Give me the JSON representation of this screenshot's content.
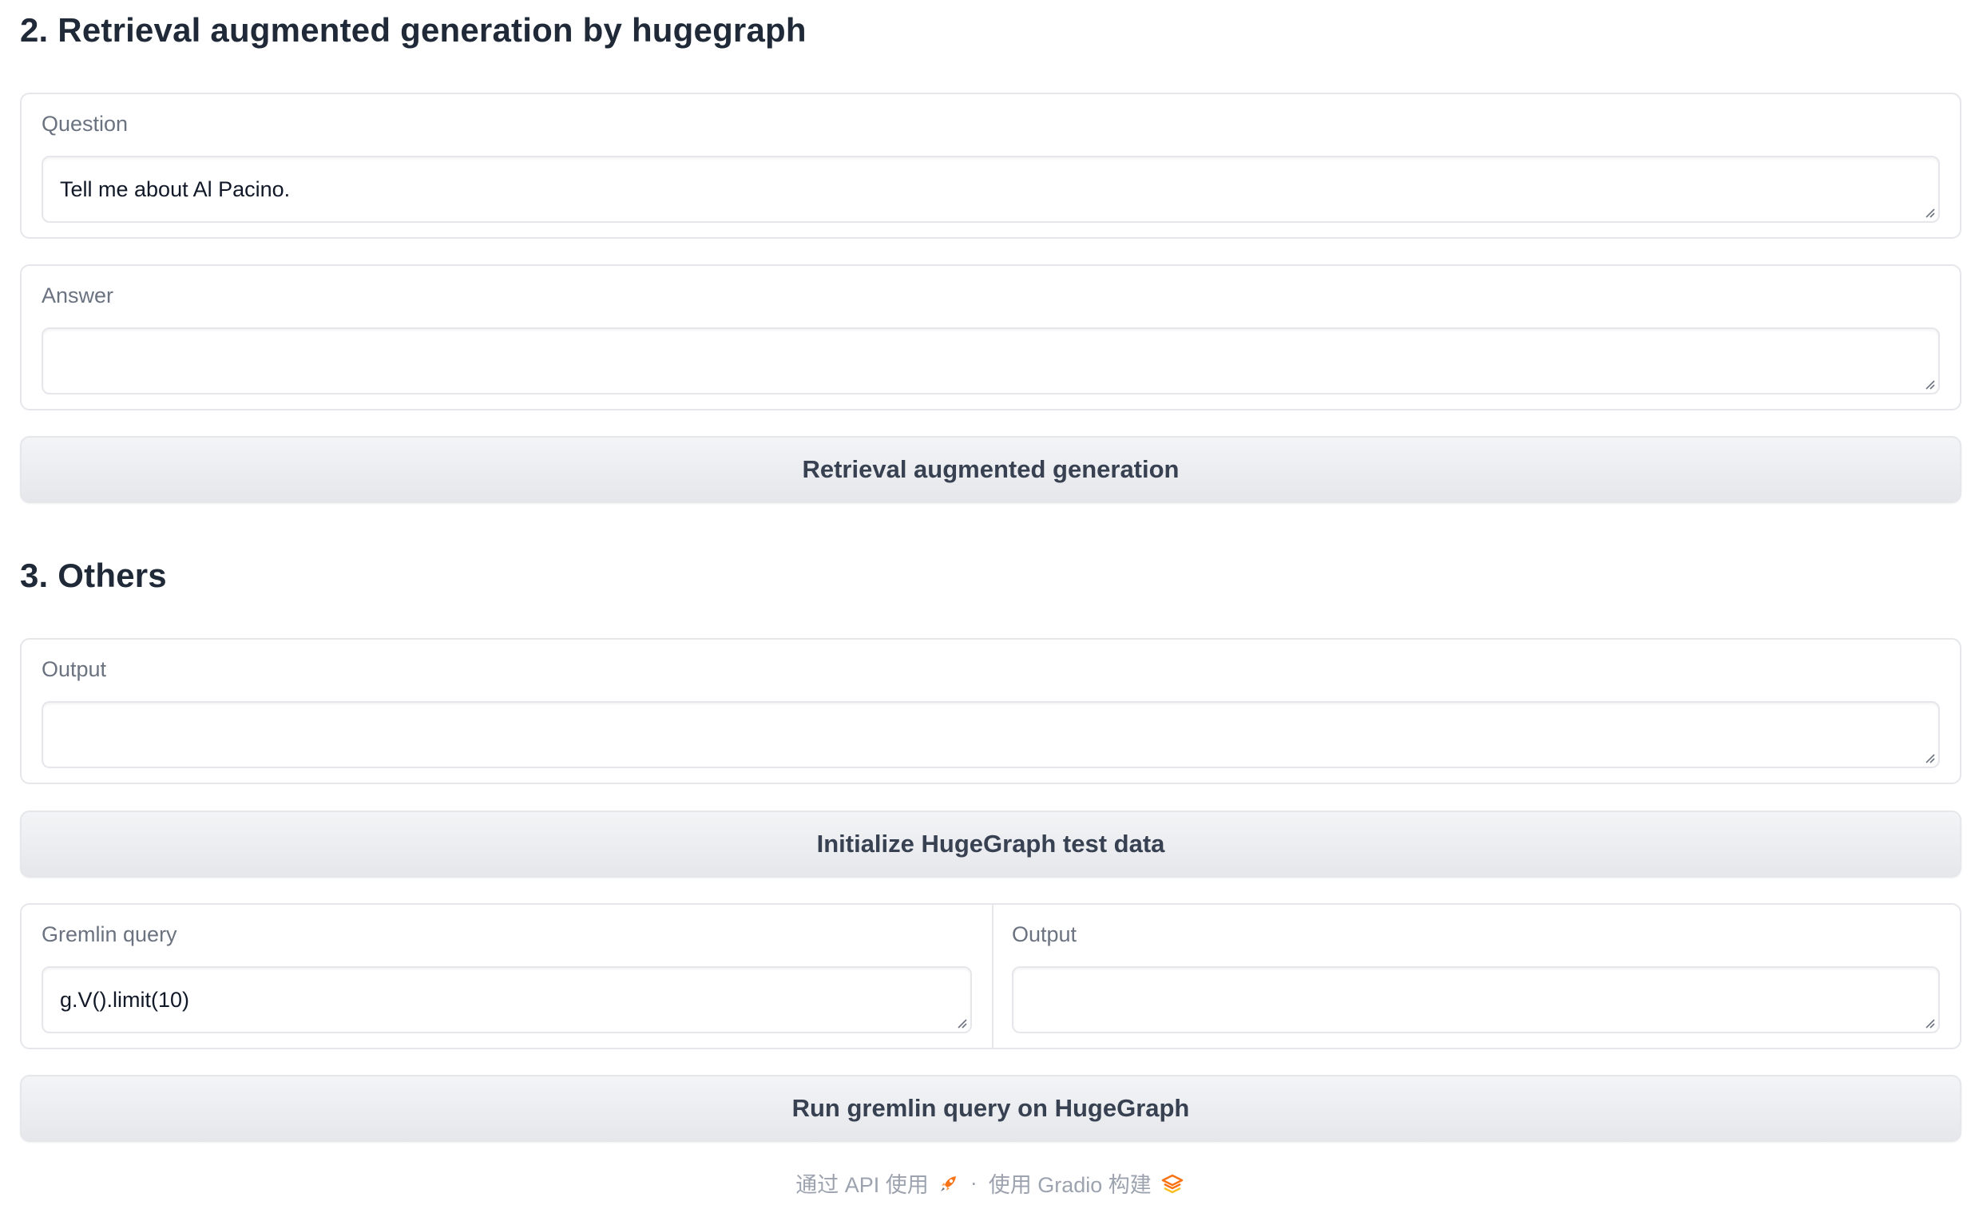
{
  "rag_section": {
    "title": "2. Retrieval augmented generation by hugegraph",
    "question_label": "Question",
    "question_value": "Tell me about Al Pacino.",
    "answer_label": "Answer",
    "answer_value": "",
    "rag_button": "Retrieval augmented generation"
  },
  "others_section": {
    "title": "3. Others",
    "output_label": "Output",
    "output_value": "",
    "init_button": "Initialize HugeGraph test data",
    "gremlin_label": "Gremlin query",
    "gremlin_value": "g.V().limit(10)",
    "gremlin_output_label": "Output",
    "gremlin_output_value": "",
    "run_button": "Run gremlin query on HugeGraph"
  },
  "footer": {
    "api_link": "通过 API 使用",
    "separator": "·",
    "built_with": "使用 Gradio 构建"
  },
  "icons": {
    "api": "rocket-icon",
    "gradio": "gradio-logo-icon"
  },
  "colors": {
    "gradio_orange": "#f97316",
    "border": "#e5e7eb"
  }
}
